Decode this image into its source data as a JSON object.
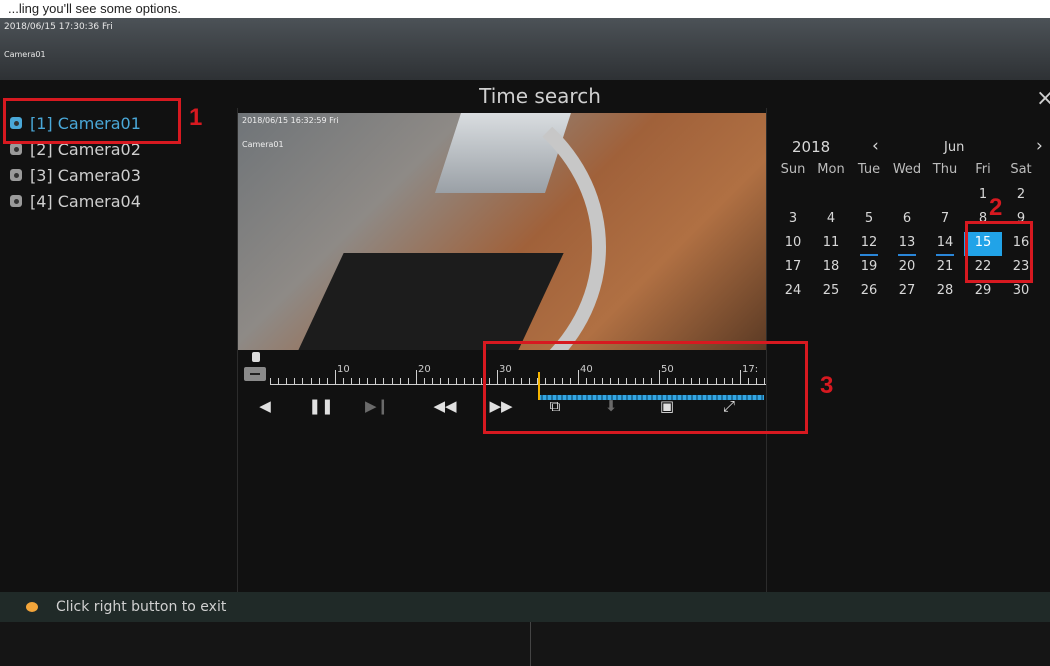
{
  "top_caption": "...ling you'll see some options.",
  "osd": {
    "datetime": "2018/06/15 17:30:36 Fri",
    "camera": "Camera01"
  },
  "dialog": {
    "title": "Time search",
    "close_icon": "close-icon"
  },
  "cameras": [
    {
      "label": "[1] Camera01",
      "active": true
    },
    {
      "label": "[2] Camera02",
      "active": false
    },
    {
      "label": "[3] Camera03",
      "active": false
    },
    {
      "label": "[4] Camera04",
      "active": false
    }
  ],
  "video": {
    "datetime": "2018/06/15 16:32:59 Fri",
    "camera": "Camera01"
  },
  "timeline": {
    "labels": [
      "10",
      "20",
      "30",
      "40",
      "50",
      "17:"
    ]
  },
  "controls": [
    {
      "name": "reverse-play-icon",
      "glyph": "◀"
    },
    {
      "name": "pause-icon",
      "glyph": "❚❚"
    },
    {
      "name": "step-forward-icon",
      "glyph": "▶❙"
    },
    {
      "name": "rewind-icon",
      "glyph": "◀◀"
    },
    {
      "name": "fast-forward-icon",
      "glyph": "▶▶"
    },
    {
      "name": "clip-icon",
      "glyph": "⧉"
    },
    {
      "name": "download-icon",
      "glyph": "⬇"
    },
    {
      "name": "snapshot-icon",
      "glyph": "▣"
    },
    {
      "name": "fullscreen-icon",
      "glyph": "⤢"
    }
  ],
  "calendar": {
    "year": "2018",
    "month": "Jun",
    "weekdays": [
      "Sun",
      "Mon",
      "Tue",
      "Wed",
      "Thu",
      "Fri",
      "Sat"
    ],
    "weeks": [
      [
        "",
        "",
        "",
        "",
        "",
        "1",
        "2"
      ],
      [
        "3",
        "4",
        "5",
        "6",
        "7",
        "8",
        "9"
      ],
      [
        "10",
        "11",
        "12",
        "13",
        "14",
        "15",
        "16"
      ],
      [
        "17",
        "18",
        "19",
        "20",
        "21",
        "22",
        "23"
      ],
      [
        "24",
        "25",
        "26",
        "27",
        "28",
        "29",
        "30"
      ]
    ],
    "recorded_days": [
      "12",
      "13",
      "14"
    ],
    "selected_day": "15"
  },
  "annotations": {
    "n1": "1",
    "n2": "2",
    "n3": "3"
  },
  "status": {
    "text": "Click right button to exit"
  },
  "colors": {
    "accent": "#21a3e8",
    "annotation": "#d71920",
    "cursor": "#f5b400"
  }
}
